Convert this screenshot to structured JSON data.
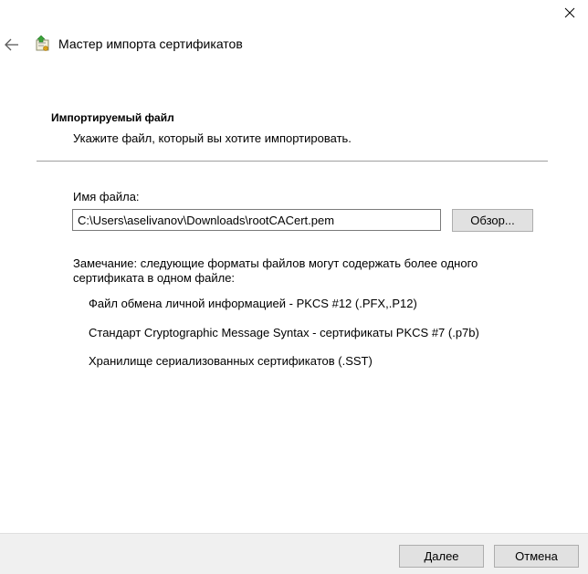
{
  "window": {
    "title": "Мастер импорта сертификатов",
    "close_icon": "close-icon",
    "back_icon": "back-arrow-icon",
    "wizard_icon": "certificate-wizard-icon"
  },
  "header": {
    "heading": "Импортируемый файл",
    "subtitle": "Укажите файл, который вы хотите импортировать."
  },
  "file_field": {
    "label": "Имя файла:",
    "value": "C:\\Users\\aselivanov\\Downloads\\rootCACert.pem",
    "browse_label": "Обзор..."
  },
  "note": {
    "text": "Замечание: следующие форматы файлов могут содержать более одного сертификата в одном файле:",
    "formats": [
      "Файл обмена личной информацией - PKCS #12 (.PFX,.P12)",
      "Стандарт Cryptographic Message Syntax - сертификаты PKCS #7 (.p7b)",
      "Хранилище сериализованных сертификатов (.SST)"
    ]
  },
  "footer": {
    "next_label": "Далее",
    "cancel_label": "Отмена"
  },
  "colors": {
    "footer_bg": "#f0f0f0",
    "button_bg": "#e1e1e1",
    "button_border": "#adadad",
    "divider": "#a0a0a0"
  }
}
